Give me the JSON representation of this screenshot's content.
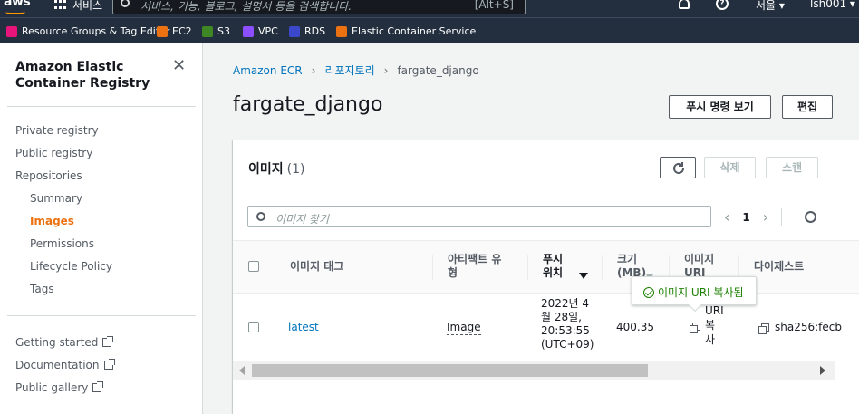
{
  "topnav": {
    "logo": "aws",
    "services_label": "서비스",
    "search_placeholder": "서비스, 기능, 블로그, 설명서 등을 검색합니다.",
    "search_shortcut": "[Alt+S]",
    "region": "서울 ▾",
    "user": "lsh001 ▾"
  },
  "favorites": [
    {
      "label": "Resource Groups & Tag Editor",
      "color": "#e7157b"
    },
    {
      "label": "EC2",
      "color": "#ec7211"
    },
    {
      "label": "S3",
      "color": "#3f8624"
    },
    {
      "label": "VPC",
      "color": "#8c4fff"
    },
    {
      "label": "RDS",
      "color": "#3b48cc"
    },
    {
      "label": "Elastic Container Service",
      "color": "#ec7211"
    }
  ],
  "sidebar": {
    "title": "Amazon Elastic Container Registry",
    "items": [
      {
        "label": "Private registry"
      },
      {
        "label": "Public registry"
      },
      {
        "label": "Repositories"
      },
      {
        "label": "Summary"
      },
      {
        "label": "Images"
      },
      {
        "label": "Permissions"
      },
      {
        "label": "Lifecycle Policy"
      },
      {
        "label": "Tags"
      }
    ],
    "links": [
      {
        "label": "Getting started"
      },
      {
        "label": "Documentation"
      },
      {
        "label": "Public gallery"
      }
    ]
  },
  "breadcrumb": {
    "items": [
      "Amazon ECR",
      "리포지토리",
      "fargate_django"
    ]
  },
  "page": {
    "title": "fargate_django",
    "push_button": "푸시 명령 보기",
    "edit_button": "편집"
  },
  "images_panel": {
    "title": "이미지",
    "count": "(1)",
    "delete_button": "삭제",
    "scan_button": "스캔",
    "filter_placeholder": "이미지 찾기",
    "page_number": "1",
    "columns": {
      "tag": "이미지 태그",
      "artifact_type": "아티팩트 유형",
      "pushed_at": "푸시 위치",
      "size": "크기 (MB)",
      "uri": "이미지 URI",
      "digest": "다이제스트"
    },
    "rows": [
      {
        "tag": "latest",
        "artifact_type": "Image",
        "pushed_at": "2022년 4 월 28일, 20:53:55 (UTC+09)",
        "size": "400.35",
        "uri": "URI 복사",
        "digest": "sha256:fecb"
      }
    ],
    "tooltip": "이미지 URI 복사됨"
  }
}
